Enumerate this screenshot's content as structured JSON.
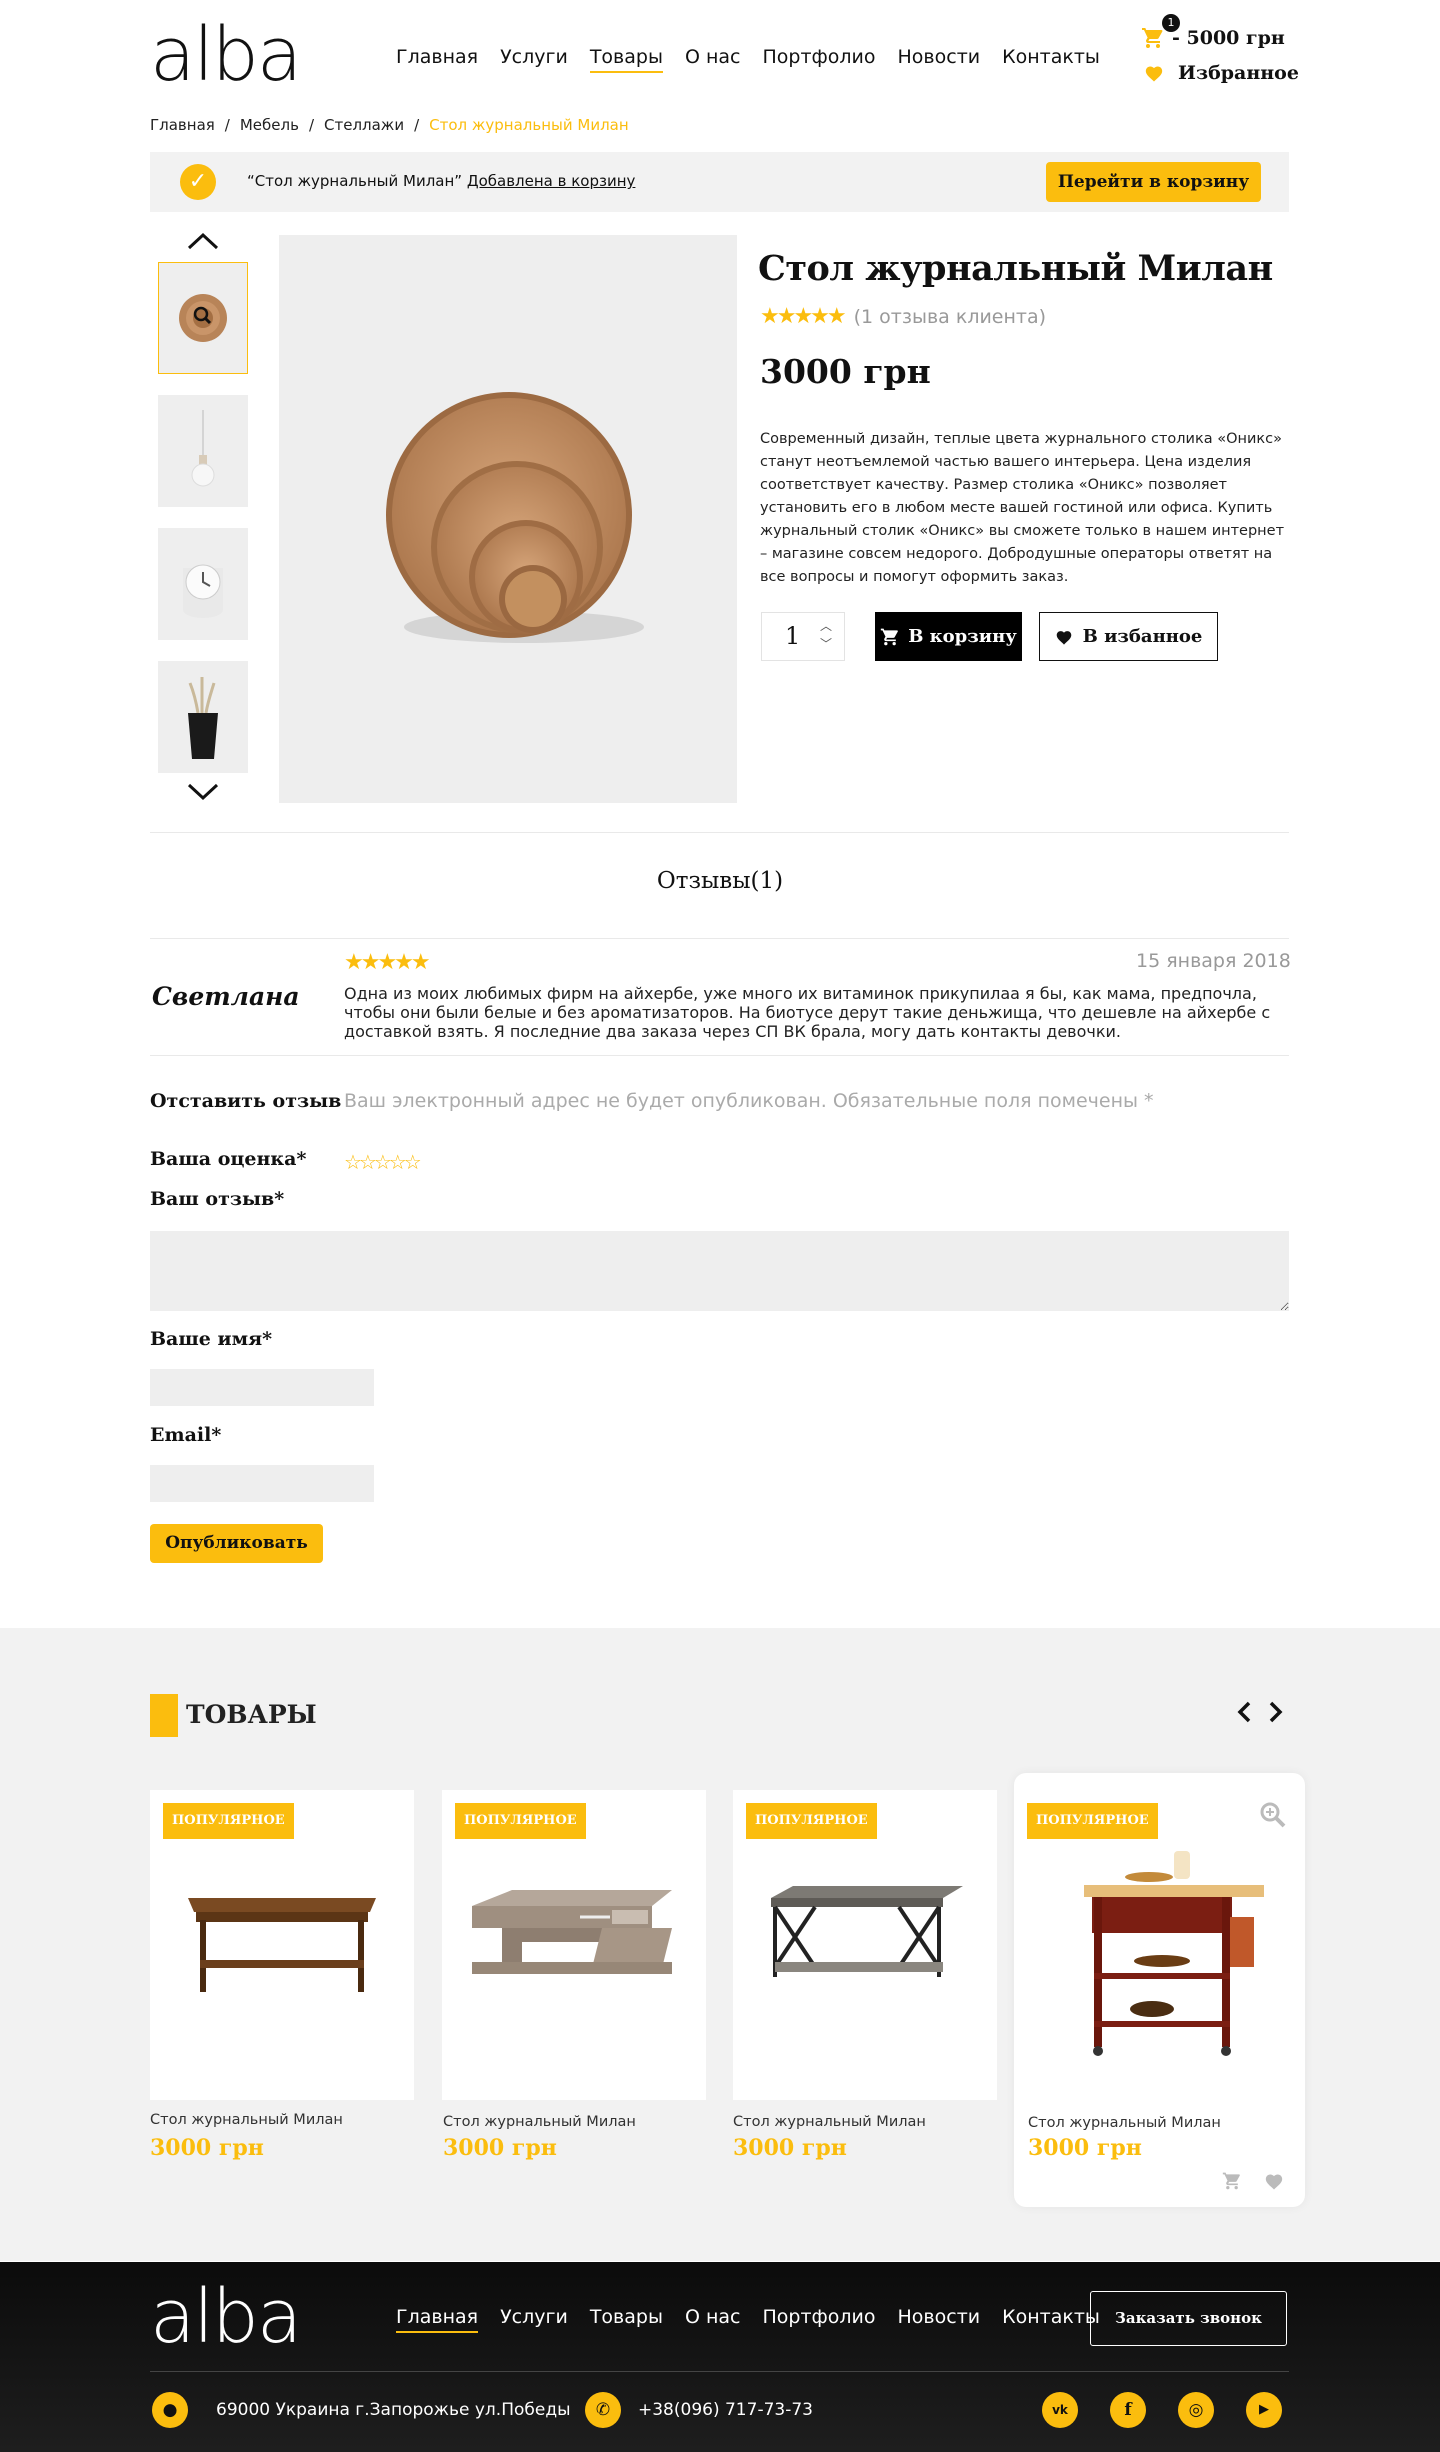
{
  "header": {
    "logo": "alba",
    "nav": [
      "Главная",
      "Услуги",
      "Товары",
      "О нас",
      "Портфолио",
      "Новости",
      "Контакты"
    ],
    "active_nav": "Товары",
    "cart_count": "1",
    "cart_total": "- 5000 грн",
    "favorites": "Избранное"
  },
  "breadcrumb": [
    "Главная",
    "Мебель",
    "Стеллажи",
    "Стол журнальный Милан"
  ],
  "notice": {
    "text": "“Стол журнальный Милан”",
    "link": "Добавлена в корзину",
    "button": "Перейти в корзину"
  },
  "product": {
    "title": "Стол журнальный Милан",
    "rating": 5,
    "reviews_count": "(1 отзыва клиента)",
    "price": "3000 грн",
    "description": "Современный дизайн, теплые цвета журнального столика «Оникс» станут неотъемлемой частью вашего интерьера. Цена изделия соответствует качеству. Размер столика «Оникс» позволяет установить его в любом месте вашей гостиной или офиса. Купить журнальный столик «Оникс» вы сможете только в нашем интернет – магазине совсем недорого. Добродушные операторы ответят на все вопросы и помогут оформить заказ.",
    "quantity": "1",
    "add_to_cart": "В корзину",
    "add_to_fav": "В избанное",
    "thumbnails": [
      "wooden-trays",
      "pendant-lamp",
      "white-clock",
      "black-vase"
    ]
  },
  "reviews": {
    "title": "Отзывы(1)",
    "items": [
      {
        "author": "Светлана",
        "rating": 5,
        "date": "15 января 2018",
        "text": "Одна из моих любимых фирм на айхербе, уже много их витаминок прикупилаа я бы, как мама, предпочла, чтобы они были белые и без ароматизаторов. На биотусе дерут такие деньжищa, что дешевле на айхербе с доставкой взять. Я последние два заказа через СП ВК брала, могу дать контакты девочки."
      }
    ]
  },
  "review_form": {
    "leave_label": "Отставить отзыв",
    "note": "Ваш электронный адрес не будет опубликован. Обязательные поля помечены *",
    "rating_label": "Ваша оценка*",
    "review_label": "Ваш отзыв*",
    "name_label": "Ваше имя*",
    "email_label": "Email*",
    "submit": "Опубликовать"
  },
  "products_section": {
    "title": "ТОВАРЫ",
    "items": [
      {
        "badge": "ПОПУЛЯРНОЕ",
        "name": "Стол журнальный Милан",
        "price": "3000 грн"
      },
      {
        "badge": "ПОПУЛЯРНОЕ",
        "name": "Стол журнальный Милан",
        "price": "3000 грн"
      },
      {
        "badge": "ПОПУЛЯРНОЕ",
        "name": "Стол журнальный Милан",
        "price": "3000 грн"
      },
      {
        "badge": "ПОПУЛЯРНОЕ",
        "name": "Стол журнальный Милан",
        "price": "3000 грн"
      }
    ]
  },
  "footer": {
    "logo": "alba",
    "nav": [
      "Главная",
      "Услуги",
      "Товары",
      "О нас",
      "Портфолио",
      "Новости",
      "Контакты"
    ],
    "active_nav": "Главная",
    "callback": "Заказать звонок",
    "address": "69000 Украина г.Запорожье ул.Победы",
    "phone": "+38(096) 717-73-73",
    "socials": [
      "vk-icon",
      "facebook-icon",
      "instagram-icon",
      "youtube-icon"
    ]
  },
  "colors": {
    "accent": "#fbbd0e",
    "panel": "#f2f2f2",
    "dark": "#111111"
  }
}
